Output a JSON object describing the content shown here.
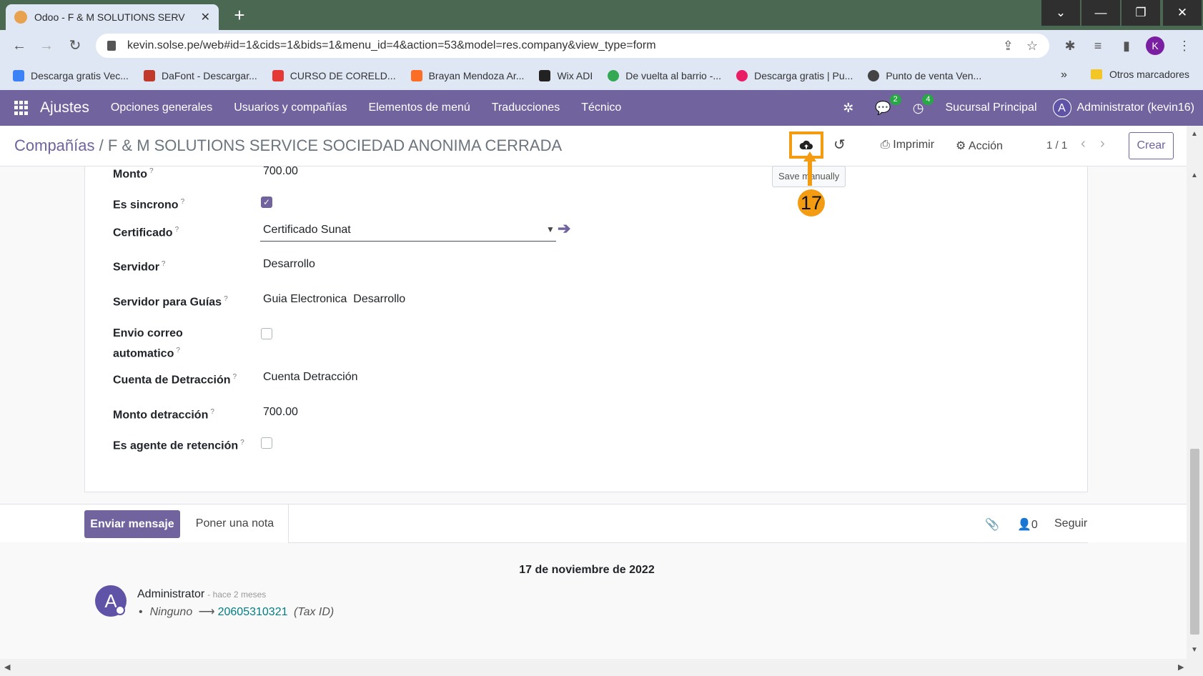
{
  "browser": {
    "tab_title": "Odoo - F & M SOLUTIONS SERV",
    "new_tab": "+",
    "url": "kevin.solse.pe/web#id=1&cids=1&bids=1&menu_id=4&action=53&model=res.company&view_type=form",
    "profile_initial": "K",
    "bookmarks": [
      {
        "label": "Descarga gratis Vec...",
        "color": "#3b82f6"
      },
      {
        "label": "DaFont - Descargar...",
        "color": "#c0392b"
      },
      {
        "label": "CURSO DE CORELD...",
        "color": "#e53935"
      },
      {
        "label": "Brayan Mendoza Ar...",
        "color": "#fc6d26"
      },
      {
        "label": "Wix ADI",
        "color": "#222222"
      },
      {
        "label": "De vuelta al barrio -...",
        "color": "#34a853"
      },
      {
        "label": "Descarga gratis | Pu...",
        "color": "#e91e63"
      },
      {
        "label": "Punto de venta Ven...",
        "color": "#444444"
      }
    ],
    "bookmarks_more": "»",
    "other_bookmarks": "Otros marcadores"
  },
  "odoo_nav": {
    "brand": "Ajustes",
    "menu": [
      "Opciones generales",
      "Usuarios y compañías",
      "Elementos de menú",
      "Traducciones",
      "Técnico"
    ],
    "messages_count": "2",
    "activities_count": "4",
    "company": "Sucursal Principal",
    "user_initial": "A",
    "user": "Administrator (kevin16)"
  },
  "control_panel": {
    "breadcrumb_parent": "Compañías",
    "breadcrumb_sep": " / ",
    "breadcrumb_current": "F & M SOLUTIONS SERVICE SOCIEDAD ANONIMA CERRADA",
    "print_label": "Imprimir",
    "action_label": "Acción",
    "pager": "1 / 1",
    "create_label": "Crear",
    "save_tooltip": "Save manually",
    "step_number": "17"
  },
  "form": {
    "monto_label": "Monto",
    "monto_value": "700.00",
    "sincrono_label": "Es sincrono",
    "sincrono_checked": true,
    "certificado_label": "Certificado",
    "certificado_value": "Certificado Sunat",
    "servidor_label": "Servidor",
    "servidor_value": "Desarrollo",
    "servidor_guias_label": "Servidor para Guías",
    "servidor_guias_value": "Guia Electronica  Desarrollo",
    "envio_label_1": "Envio correo",
    "envio_label_2": "automatico",
    "envio_checked": false,
    "cuenta_label": "Cuenta de Detracción",
    "cuenta_value": "Cuenta Detracción",
    "monto_detraccion_label": "Monto detracción",
    "monto_detraccion_value": "700.00",
    "agente_label": "Es agente de retención",
    "agente_checked": false,
    "help_mark": "?"
  },
  "chatter": {
    "send_label": "Enviar mensaje",
    "note_label": "Poner una nota",
    "followers_count": "0",
    "follow_label": "Seguir",
    "date_separator": "17 de noviembre de 2022",
    "author_initial": "A",
    "author": "Administrator",
    "time_ago": "- hace 2 meses",
    "change_old": "Ninguno",
    "change_new": "20605310321",
    "change_field": "(Tax ID)"
  }
}
